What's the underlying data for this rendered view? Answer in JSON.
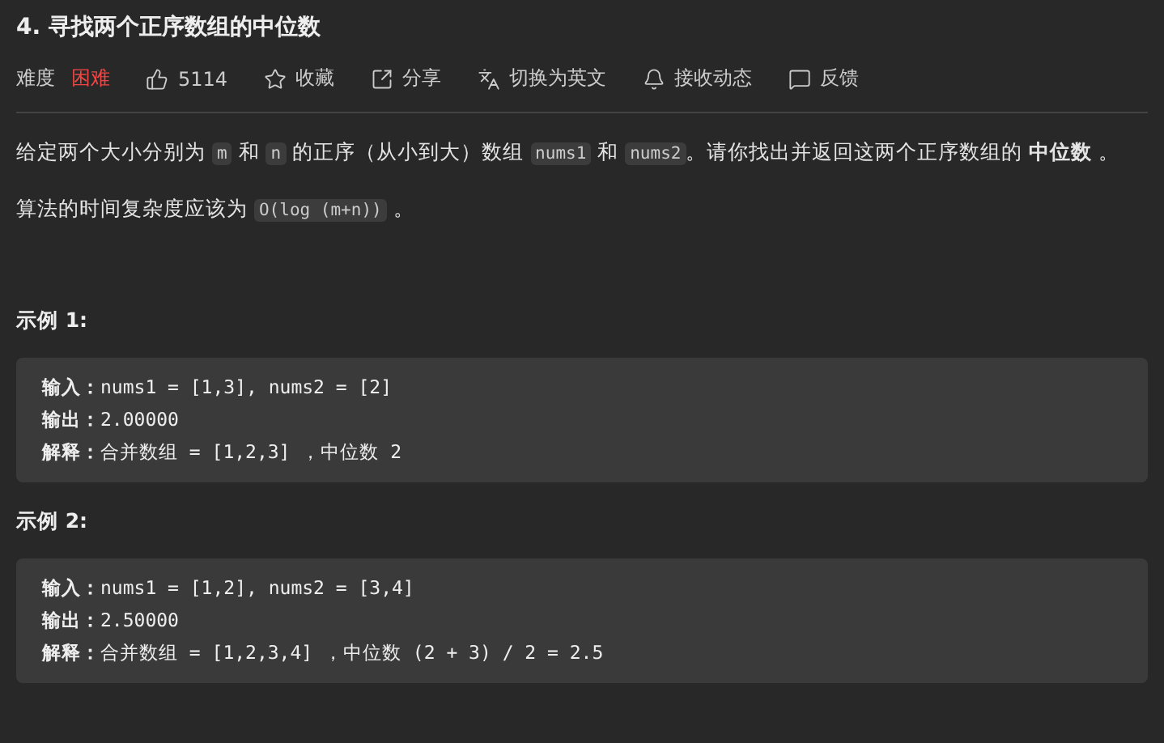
{
  "title": "4. 寻找两个正序数组的中位数",
  "toolbar": {
    "difficulty_label": "难度",
    "difficulty": "困难",
    "actions": [
      {
        "kind": "like",
        "label": "5114"
      },
      {
        "kind": "star",
        "label": "收藏"
      },
      {
        "kind": "share",
        "label": "分享"
      },
      {
        "kind": "translate",
        "label": "切换为英文"
      },
      {
        "kind": "bell",
        "label": "接收动态"
      },
      {
        "kind": "feedback",
        "label": "反馈"
      }
    ]
  },
  "description": [
    [
      {
        "kind": "text",
        "text": "给定两个大小分别为 "
      },
      {
        "kind": "code",
        "text": "m"
      },
      {
        "kind": "text",
        "text": " 和 "
      },
      {
        "kind": "code",
        "text": "n"
      },
      {
        "kind": "text",
        "text": " 的正序（从小到大）数组 "
      },
      {
        "kind": "code",
        "text": "nums1"
      },
      {
        "kind": "text",
        "text": " 和 "
      },
      {
        "kind": "code",
        "text": "nums2"
      },
      {
        "kind": "text",
        "text": "。请你找出并返回这两个正序数组的 "
      },
      {
        "kind": "bold",
        "text": "中位数"
      },
      {
        "kind": "text",
        "text": " 。"
      }
    ],
    [
      {
        "kind": "text",
        "text": "算法的时间复杂度应该为 "
      },
      {
        "kind": "code",
        "text": "O(log (m+n))"
      },
      {
        "kind": "text",
        "text": " 。"
      }
    ]
  ],
  "examples": [
    {
      "heading": "示例 1:",
      "lines": [
        "**输入：**nums1 = [1,3], nums2 = [2]",
        "**输出：**2.00000",
        "**解释：**合并数组 = [1,2,3] ，中位数 2"
      ]
    },
    {
      "heading": "示例 2:",
      "lines": [
        "**输入：**nums1 = [1,2], nums2 = [3,4]",
        "**输出：**2.50000",
        "**解释：**合并数组 = [1,2,3,4] ，中位数 (2 + 3) / 2 = 2.5"
      ]
    }
  ]
}
